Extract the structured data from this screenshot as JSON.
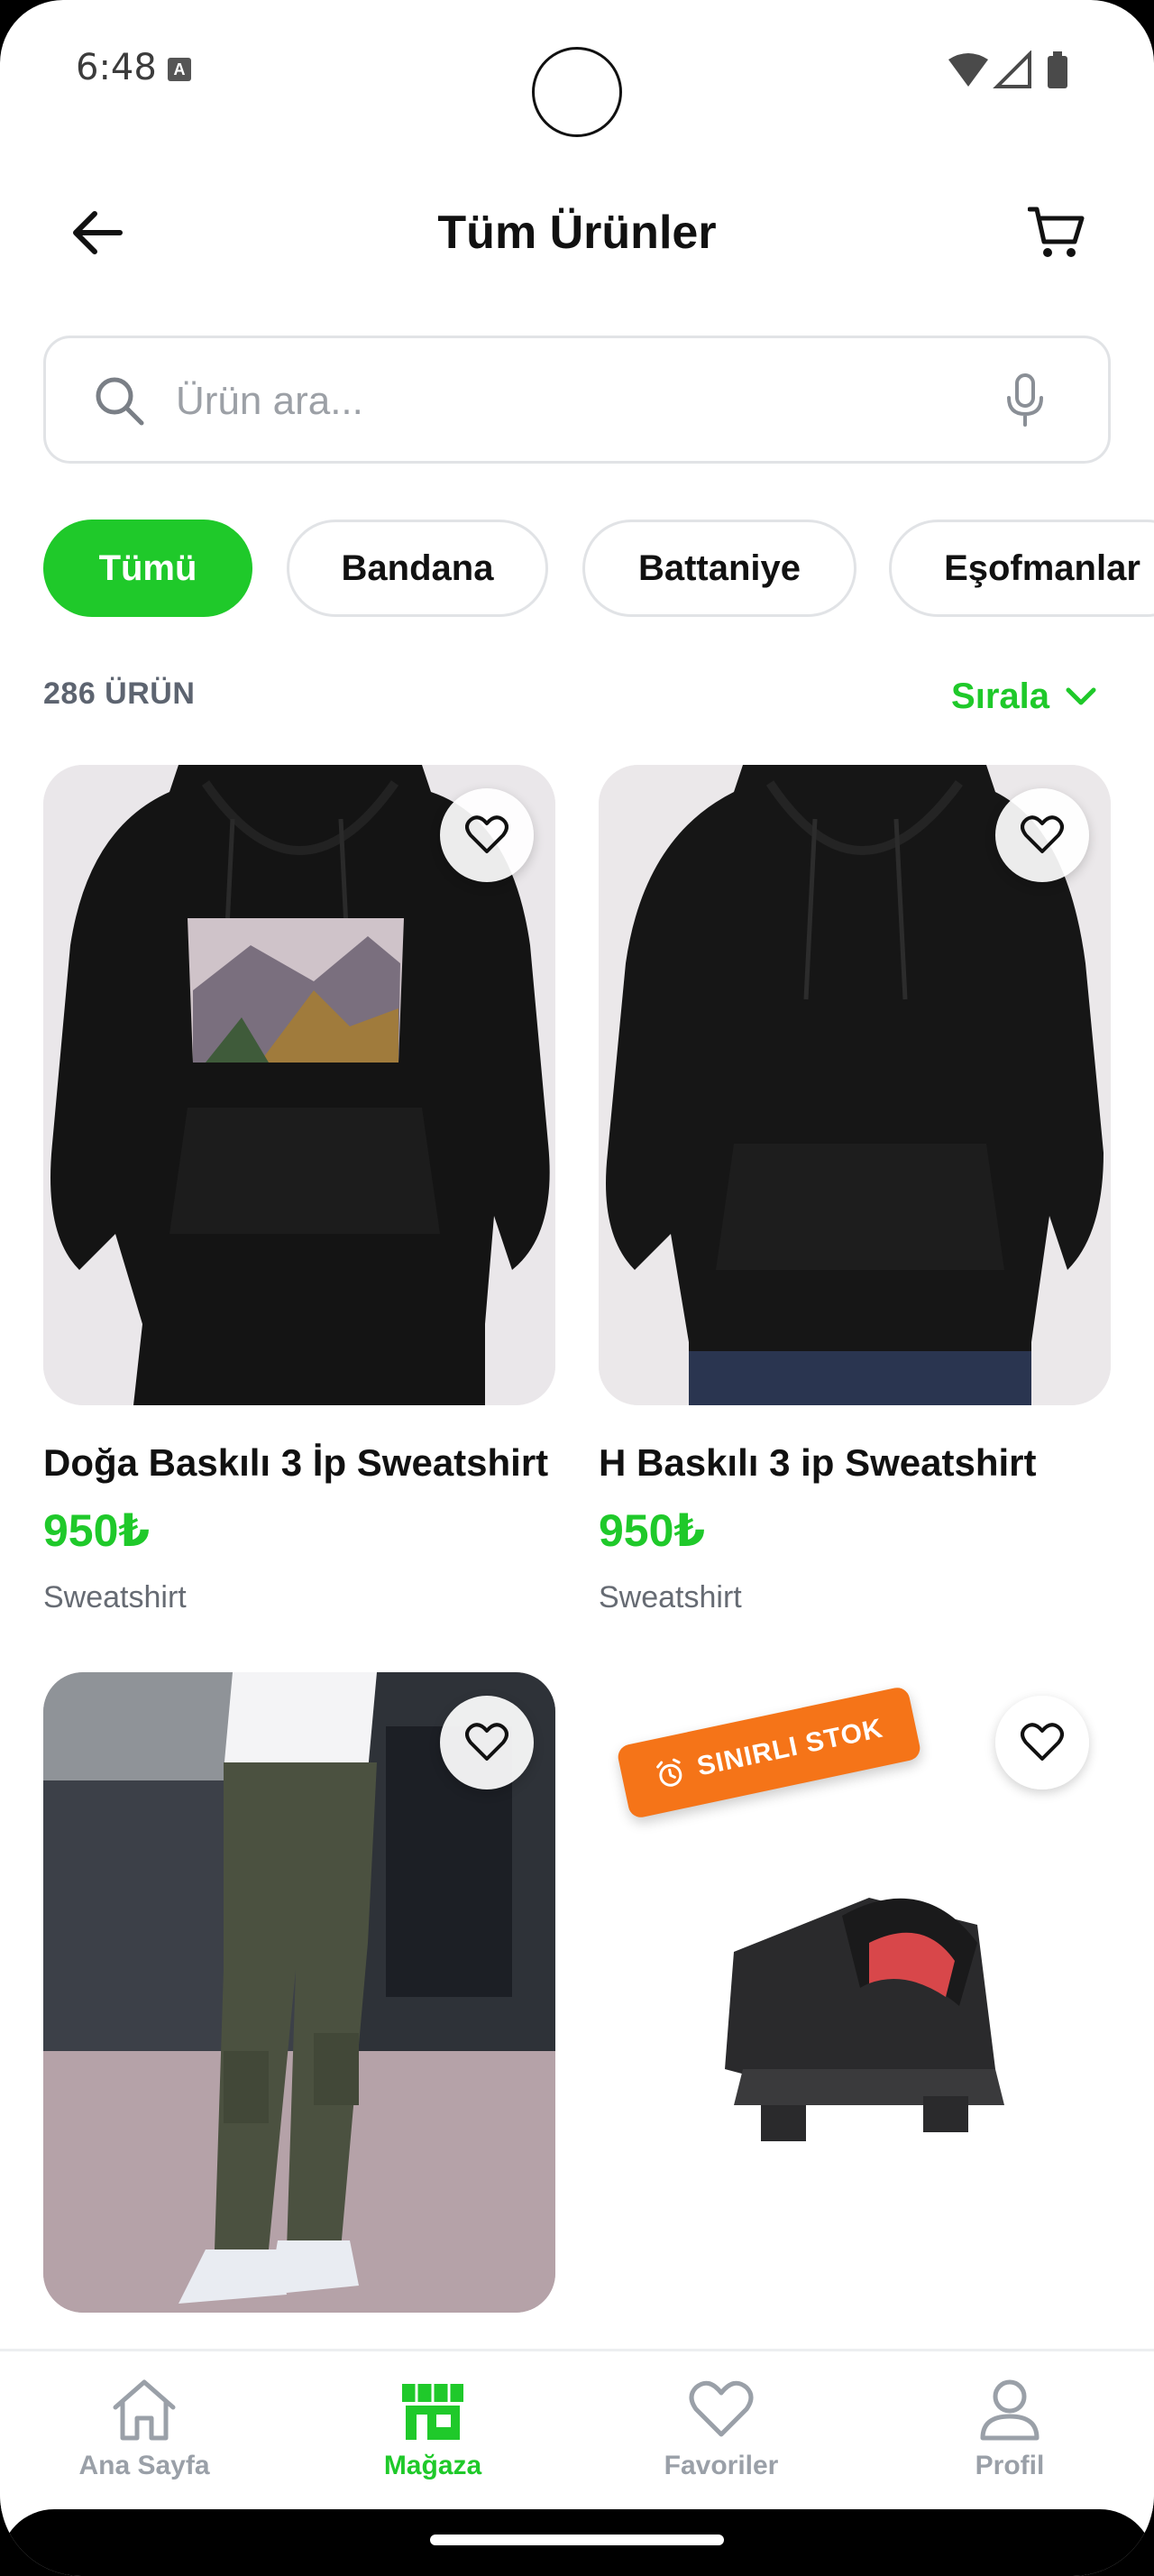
{
  "status_bar": {
    "time": "6:48",
    "notification_letter": "A"
  },
  "header": {
    "title": "Tüm Ürünler"
  },
  "search": {
    "placeholder": "Ürün ara..."
  },
  "chips": [
    {
      "label": "Tümü",
      "active": true
    },
    {
      "label": "Bandana",
      "active": false
    },
    {
      "label": "Battaniye",
      "active": false
    },
    {
      "label": "Eşofmanlar",
      "active": false
    }
  ],
  "list": {
    "count_label": "286 ÜRÜN",
    "sort_label": "Sırala"
  },
  "products": [
    {
      "title": "Doğa Baskılı 3 İp Sweatshirt",
      "price": "950₺",
      "category": "Sweatshirt"
    },
    {
      "title": "H Baskılı 3 ip Sweatshirt",
      "price": "950₺",
      "category": "Sweatshirt"
    },
    {
      "title": "",
      "price": "",
      "category": ""
    },
    {
      "title": "",
      "price": "",
      "category": "",
      "badge": "SINIRLI STOK"
    }
  ],
  "bottom_nav": [
    {
      "label": "Ana Sayfa",
      "icon": "home-icon",
      "active": false
    },
    {
      "label": "Mağaza",
      "icon": "store-icon",
      "active": true
    },
    {
      "label": "Favoriler",
      "icon": "heart-icon",
      "active": false
    },
    {
      "label": "Profil",
      "icon": "user-icon",
      "active": false
    }
  ],
  "colors": {
    "accent": "#1fc92a",
    "badge": "#f57418",
    "text": "#111111",
    "muted": "#666b73"
  }
}
